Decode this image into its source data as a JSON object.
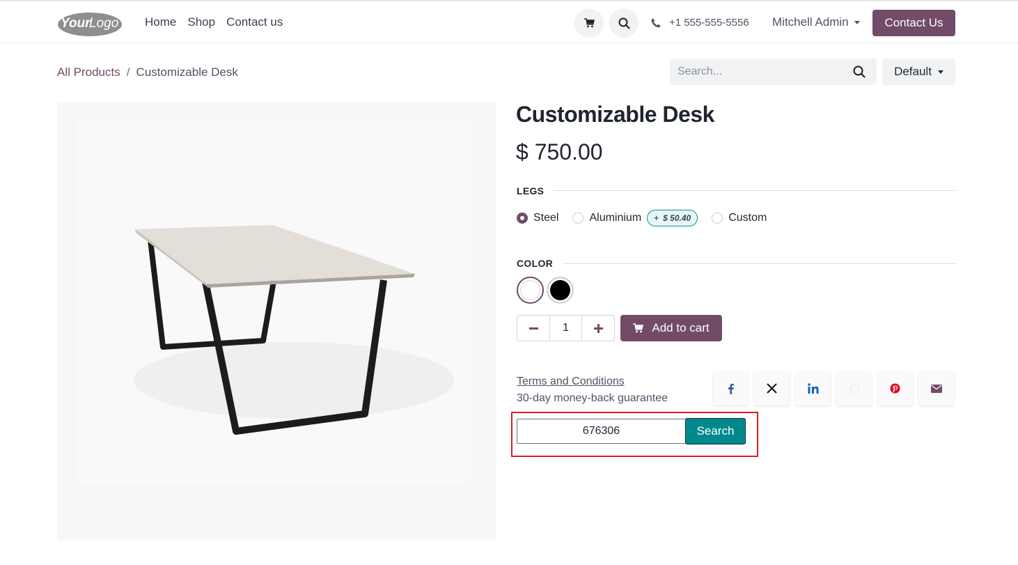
{
  "header": {
    "logo_text": "YourLogo",
    "nav": [
      "Home",
      "Shop",
      "Contact us"
    ],
    "phone": "+1 555-555-5556",
    "user": "Mitchell Admin",
    "contact_button": "Contact Us"
  },
  "breadcrumb": {
    "all_products": "All Products",
    "separator": "/",
    "current": "Customizable Desk"
  },
  "product_search": {
    "placeholder": "Search..."
  },
  "sort": {
    "label": "Default"
  },
  "product": {
    "name": "Customizable Desk",
    "price": "$ 750.00",
    "legs": {
      "label": "LEGS",
      "options": [
        "Steel",
        "Aluminium",
        "Custom"
      ],
      "selected": "Steel",
      "aluminium_extra_plus": "+",
      "aluminium_extra_price": "$ 50.40"
    },
    "color": {
      "label": "COLOR",
      "swatches": [
        "#ffffff",
        "#000000"
      ],
      "selected": "#ffffff"
    },
    "quantity": "1",
    "add_to_cart": "Add to cart",
    "terms": "Terms and Conditions",
    "guarantee": "30-day money-back guarantee"
  },
  "code_search": {
    "value": "676306",
    "button": "Search"
  },
  "colors": {
    "brand": "#714b67",
    "search_button": "#00898c",
    "highlight": "#d92020"
  },
  "share_icons": [
    "facebook-icon",
    "x-icon",
    "linkedin-icon",
    "whatsapp-icon",
    "pinterest-icon",
    "email-icon"
  ]
}
